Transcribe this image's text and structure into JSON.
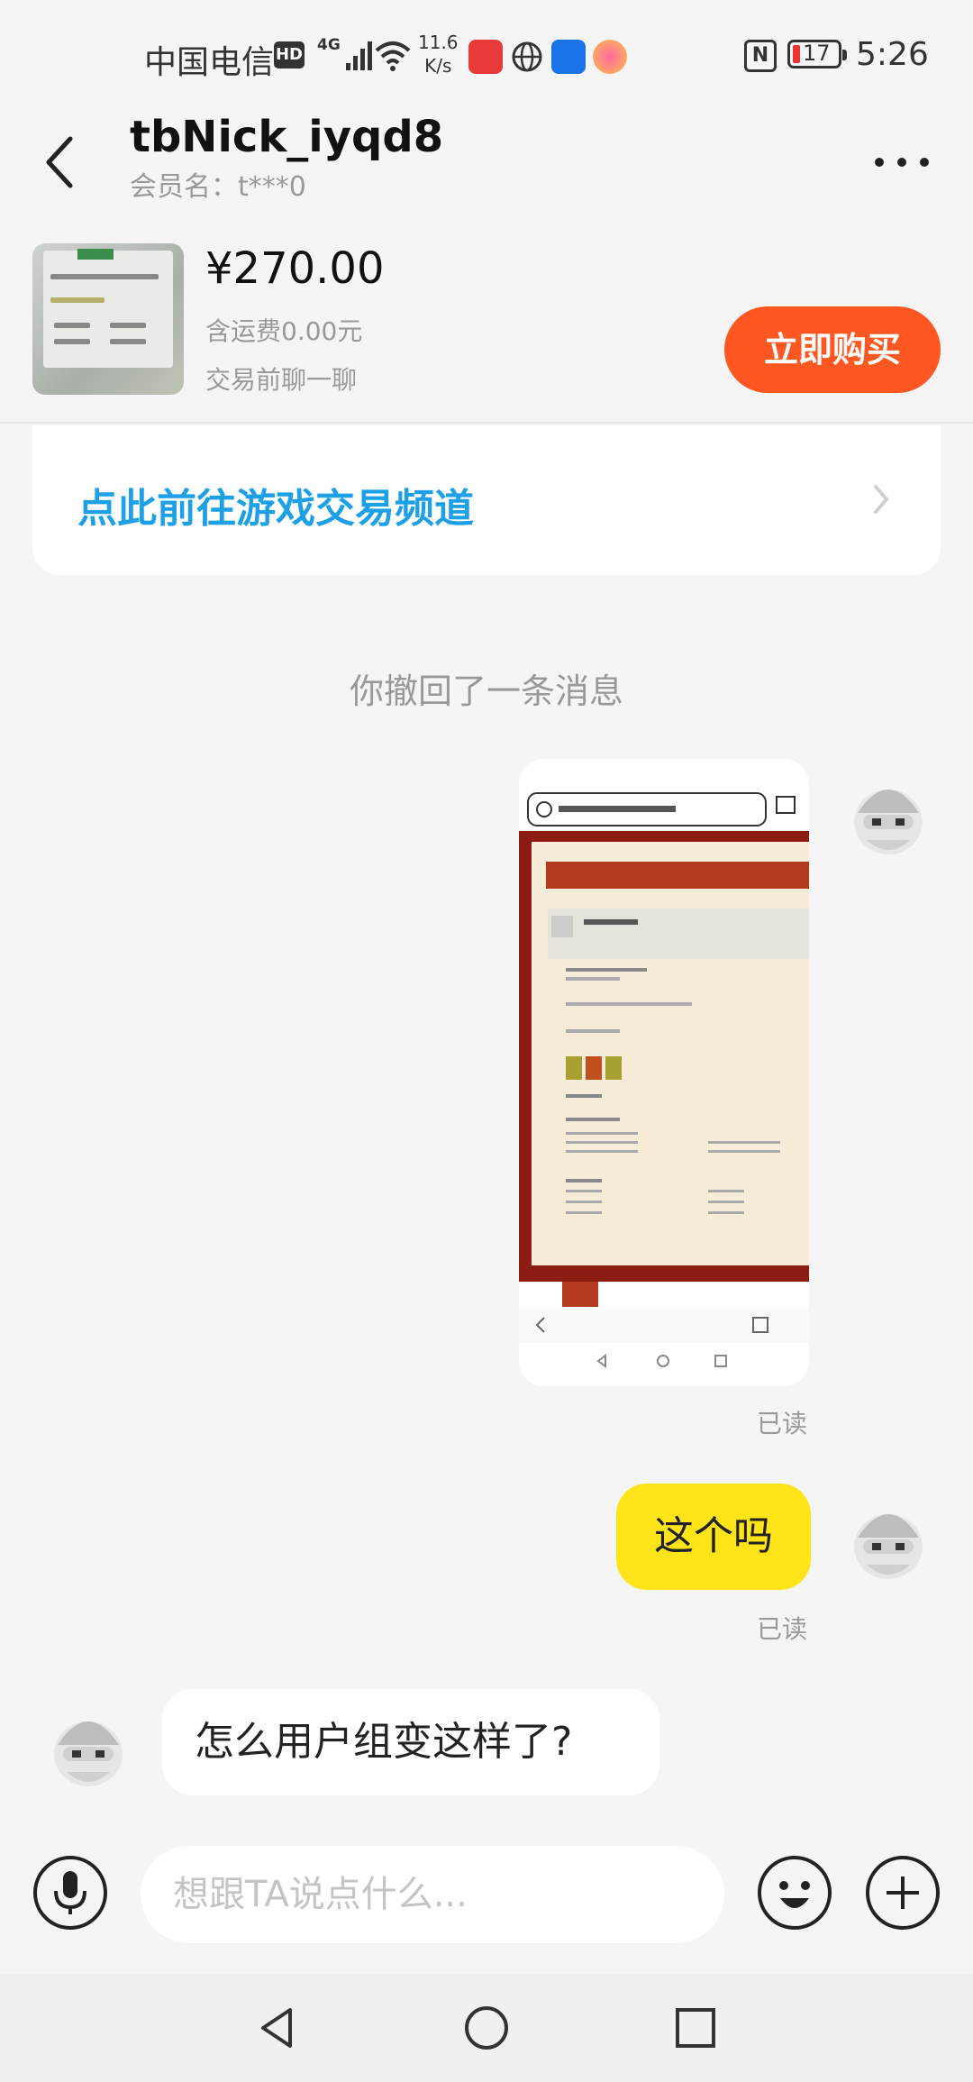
{
  "status_bar": {
    "carrier": "中国电信",
    "hd": "HD",
    "network": "4G",
    "speed_value": "11.6",
    "speed_unit": "K/s",
    "battery": "17",
    "time": "5:26"
  },
  "header": {
    "title": "tbNick_iyqd8",
    "subtitle": "会员名：t***0"
  },
  "product": {
    "price": "¥270.00",
    "shipping": "含运费0.00元",
    "chat_first": "交易前聊一聊",
    "buy_label": "立即购买"
  },
  "banner": {
    "text": "点此前往游戏交易频道"
  },
  "chat": {
    "recall_notice": "你撤回了一条消息",
    "read_label_1": "已读",
    "my_text": "这个吗",
    "read_label_2": "已读",
    "other_text": "怎么用户组变这样了?"
  },
  "input": {
    "placeholder": "想跟TA说点什么..."
  },
  "colors": {
    "buy_button": "#ff5722",
    "banner_text": "#1ea0e6",
    "my_bubble": "#ffe41a"
  }
}
